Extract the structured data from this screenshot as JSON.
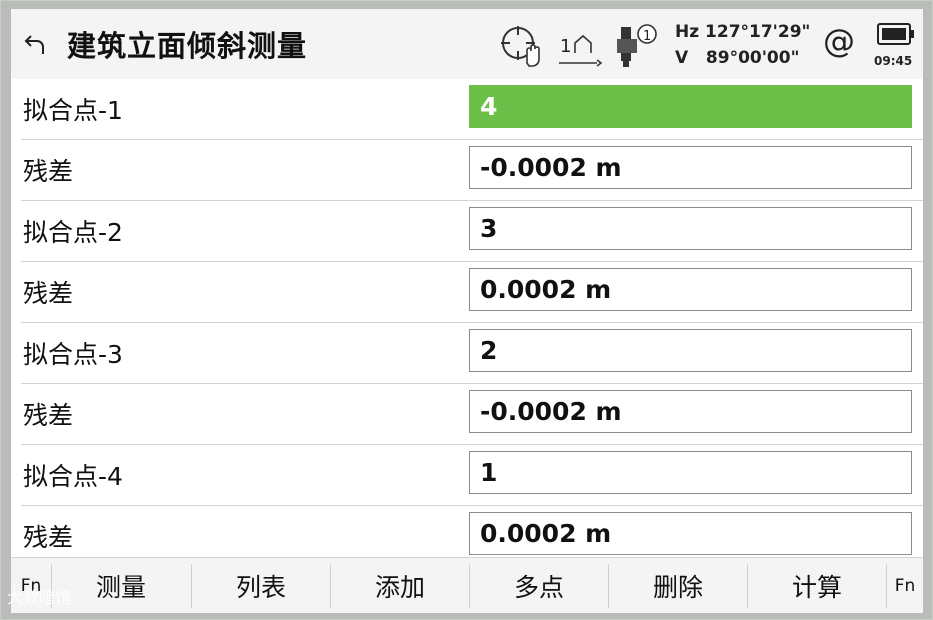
{
  "header": {
    "title": "建筑立面倾斜测量",
    "hz_line": "Hz 127°17'29\"",
    "v_line": "V   89°00'00\"",
    "target_count": "1",
    "face": "1",
    "time": "09:45",
    "at_symbol": "@",
    "icons": [
      "back-arrow-icon",
      "crosshair-hand-icon",
      "target-height-icon",
      "instrument-face-icon",
      "at-icon",
      "battery-icon"
    ]
  },
  "rows": [
    {
      "label": "拟合点-1",
      "value": "4",
      "active": true
    },
    {
      "label": "残差",
      "value": "-0.0002 m",
      "active": false
    },
    {
      "label": "拟合点-2",
      "value": "3",
      "active": false
    },
    {
      "label": "残差",
      "value": "0.0002 m",
      "active": false
    },
    {
      "label": "拟合点-3",
      "value": "2",
      "active": false
    },
    {
      "label": "残差",
      "value": "-0.0002 m",
      "active": false
    },
    {
      "label": "拟合点-4",
      "value": "1",
      "active": false
    },
    {
      "label": "残差",
      "value": "0.0002 m",
      "active": false
    }
  ],
  "toolbar": {
    "fn_left": "Fn",
    "buttons": [
      "测量",
      "列表",
      "添加",
      "多点",
      "删除",
      "计算"
    ],
    "fn_right": "Fn"
  },
  "watermark": "大数暗馆",
  "colors": {
    "active_field": "#6cc04a",
    "header_bg": "#f3f4f3",
    "frame": "#b9bcb9"
  }
}
